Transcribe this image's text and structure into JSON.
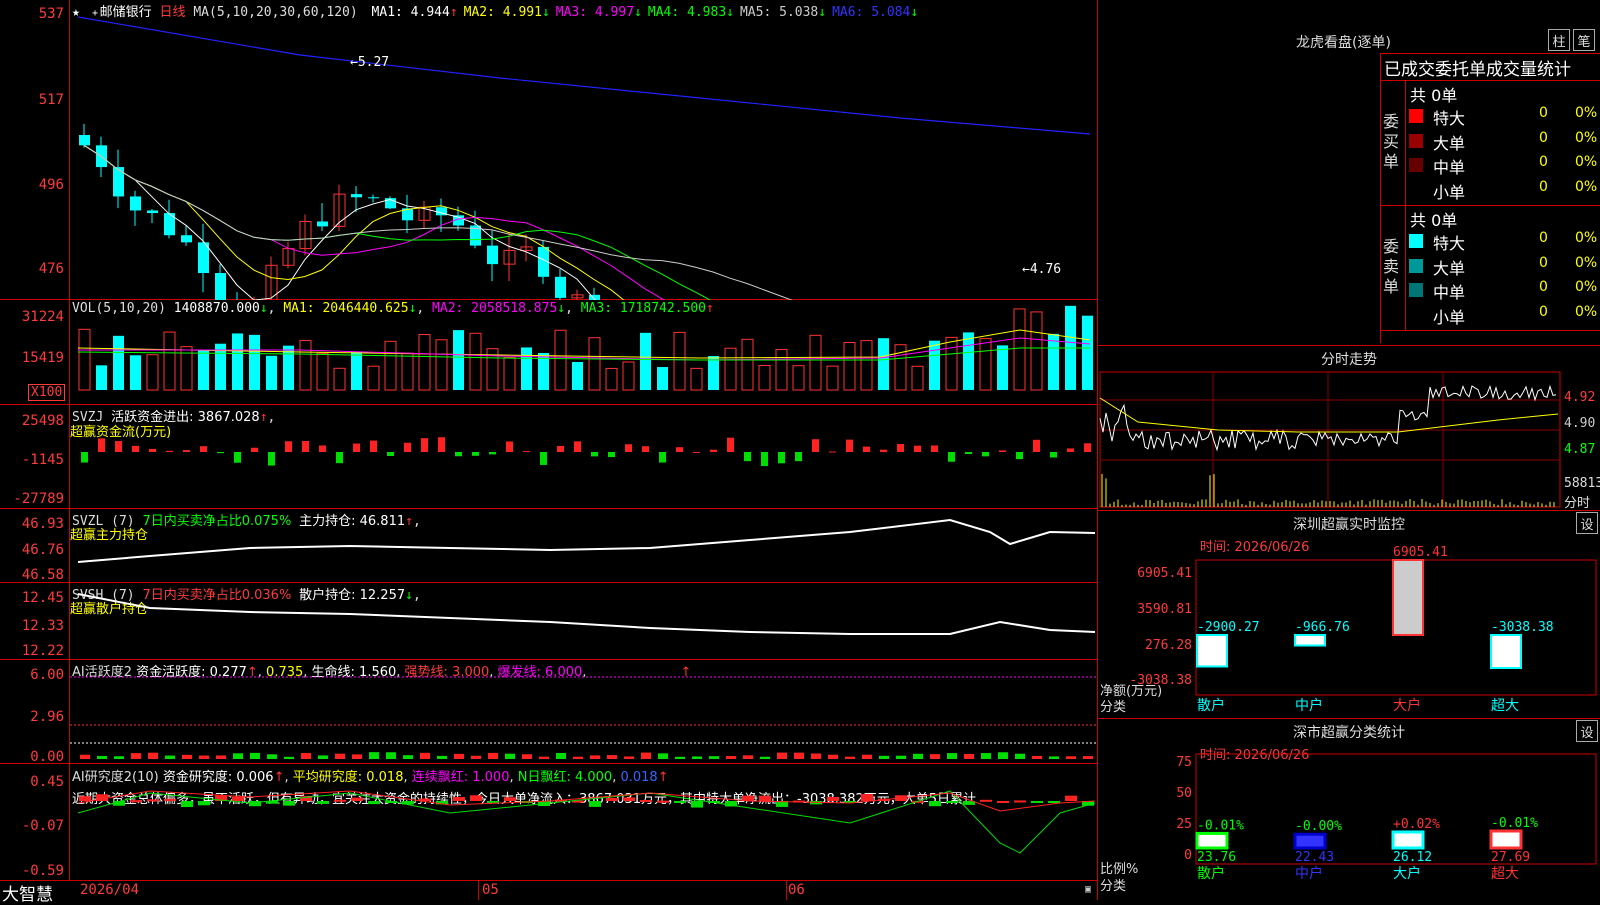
{
  "header": {
    "stock_name": "邮储银行",
    "period": "日线",
    "ma_label": "MA(5,10,20,30,60,120)",
    "ma": [
      {
        "text": "MA1: 4.944",
        "arrow": "↑",
        "color": "#ffffff"
      },
      {
        "text": "MA2: 4.991",
        "arrow": "↓",
        "color": "#ffff00"
      },
      {
        "text": "MA3: 4.997",
        "arrow": "↓",
        "color": "#ff00ff"
      },
      {
        "text": "MA4: 4.983",
        "arrow": "↓",
        "color": "#00ff00"
      },
      {
        "text": "MA5: 5.038",
        "arrow": "↓",
        "color": "#cccccc"
      },
      {
        "text": "MA6: 5.084",
        "arrow": "↓",
        "color": "#3333ff"
      }
    ]
  },
  "price_chart": {
    "y_ticks": [
      "537",
      "517",
      "496",
      "476"
    ],
    "high_label": "5.27",
    "low_label": "4.76"
  },
  "vol": {
    "label": "VOL(5,10,20)",
    "value": "1408870.000",
    "ma1": "MA1: 2046440.625",
    "ma2": "MA2: 2058518.875",
    "ma3": "MA3: 1718742.500",
    "y_ticks": [
      "31224",
      "15419",
      "X100"
    ]
  },
  "svzj": {
    "label": "SVZJ",
    "text": "活跃资金进出: 3867.028",
    "sub": "超赢资金流(万元)",
    "y_ticks": [
      "25498",
      "-1145",
      "-27789"
    ]
  },
  "svzl": {
    "label": "SVZL (7)",
    "ratio": "7日内买卖净占比0.075%",
    "text": "主力持仓: 46.811",
    "sub": "超赢主力持仓",
    "y_ticks": [
      "46.93",
      "46.76",
      "46.58"
    ]
  },
  "svsh": {
    "label": "SVSH (7)",
    "ratio": "7日内买卖净占比0.036%",
    "text": "散户持仓: 12.257",
    "sub": "超赢散户持仓",
    "y_ticks": [
      "12.45",
      "12.33",
      "12.22"
    ]
  },
  "ai_active": {
    "label": "AI活跃度2",
    "text1": "资金活跃度: 0.277",
    "text2": "0.735",
    "text3": "生命线: 1.560",
    "strong": "强势线: 3.000",
    "burst": "爆发线: 6.000",
    "y_ticks": [
      "6.00",
      "2.96",
      "0.00"
    ]
  },
  "ai_research": {
    "label": "AI研究度2(10)",
    "text1": "资金研究度: 0.006",
    "text2": "平均研究度: 0.018",
    "text3": "连续飘红: 1.000",
    "text4": "N日飘红: 4.000",
    "text5": "0.018",
    "note": "近期大资金总体偏多，虽不活跃，但有异动，宜关注大资金的持续性，今日大单净流入：3867.031万元，其中特大单净流出：-3038.382万元，大单5日累计",
    "y_ticks": [
      "0.45",
      "-0.07",
      "-0.59"
    ]
  },
  "bottom": {
    "brand": "大智慧",
    "dates": [
      "2026/04",
      "05",
      "06"
    ]
  },
  "dragon_tiger": {
    "title": "龙虎看盘(逐单)",
    "btn1": "柱",
    "btn2": "笔",
    "subtitle": "已成交委托单成交量统计",
    "buy_label": "委买单",
    "sell_label": "委卖单",
    "buy_total": "共 0单",
    "sell_total": "共 0单",
    "buy_rows": [
      {
        "name": "特大",
        "val": "0",
        "pct": "0%",
        "color": "#ff0000"
      },
      {
        "name": "大单",
        "val": "0",
        "pct": "0%",
        "color": "#990000"
      },
      {
        "name": "中单",
        "val": "0",
        "pct": "0%",
        "color": "#660000"
      },
      {
        "name": "小单",
        "val": "0",
        "pct": "0%",
        "color": "#000000"
      }
    ],
    "sell_rows": [
      {
        "name": "特大",
        "val": "0",
        "pct": "0%",
        "color": "#00ffff"
      },
      {
        "name": "大单",
        "val": "0",
        "pct": "0%",
        "color": "#009999"
      },
      {
        "name": "中单",
        "val": "0",
        "pct": "0%",
        "color": "#007777"
      },
      {
        "name": "小单",
        "val": "0",
        "pct": "0%",
        "color": "#000000"
      }
    ]
  },
  "intraday": {
    "title": "分时走势",
    "y_ticks": [
      "4.92",
      "4.90",
      "4.87"
    ],
    "vol_tick": "58813",
    "vol_label": "分时"
  },
  "sz_monitor": {
    "title": "深圳超赢实时监控",
    "settings": "设",
    "time": "时间: 2026/06/26",
    "y_ticks": [
      "6905.41",
      "3590.81",
      "276.28",
      "-3038.38"
    ],
    "unit1": "净额(万元)",
    "unit2": "分类",
    "categories": [
      "散户",
      "中户",
      "大户",
      "超大"
    ],
    "values": [
      -2900.27,
      -966.76,
      6905.41,
      -3038.38
    ],
    "value_labels": [
      "-2900.27",
      "-966.76",
      "6905.41",
      "-3038.38"
    ]
  },
  "sz_class": {
    "title": "深市超赢分类统计",
    "settings": "设",
    "time": "时间: 2026/06/26",
    "y_ticks": [
      "75",
      "50",
      "25",
      "0"
    ],
    "unit1": "比例%",
    "unit2": "分类",
    "categories": [
      "散户",
      "中户",
      "大户",
      "超大"
    ],
    "values": [
      23.76,
      22.43,
      26.12,
      27.69
    ],
    "value_labels": [
      "23.76",
      "22.43",
      "26.12",
      "27.69"
    ],
    "change_labels": [
      "-0.01%",
      "-0.00%",
      "+0.02%",
      "-0.01%"
    ]
  }
}
